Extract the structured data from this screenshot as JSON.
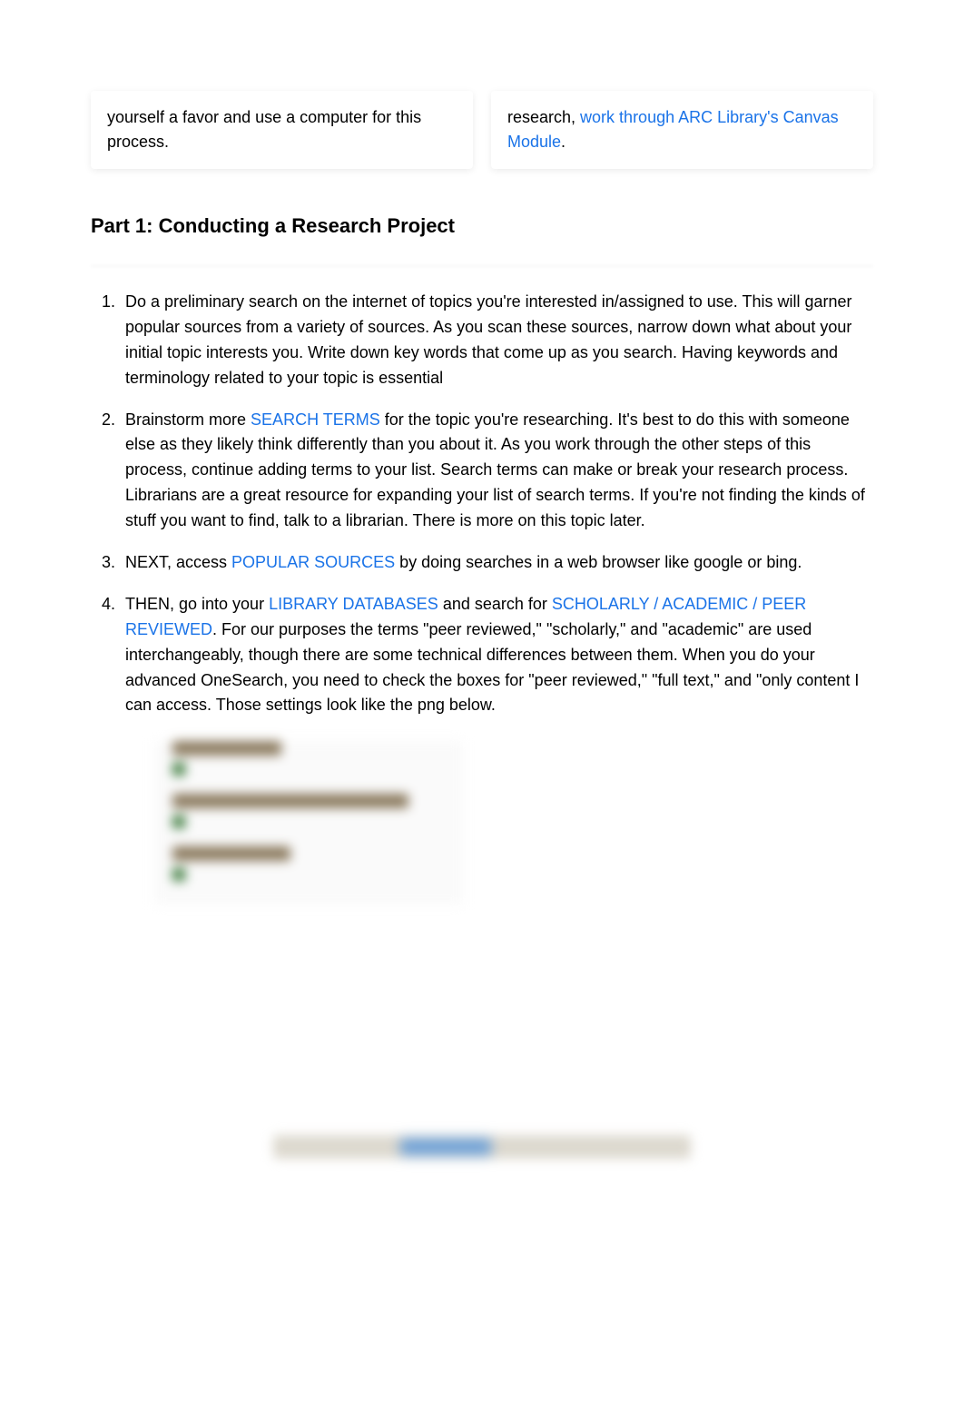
{
  "topBoxLeft": {
    "text": "yourself a favor and use a computer for this process."
  },
  "topBoxRight": {
    "prefix": "research, ",
    "linkText": "work through ARC Library's Canvas Module",
    "suffix": "."
  },
  "heading": "Part 1: Conducting a Research Project",
  "items": {
    "item1": "Do a preliminary search on the internet of topics you're interested in/assigned to use. This will garner popular sources from a variety of sources. As you scan these sources, narrow down what about your initial topic interests you. Write down key words that come up as you search. Having keywords and terminology related to your topic is essential",
    "item2": {
      "prefix": "Brainstorm more ",
      "link": "SEARCH TERMS",
      "suffix": " for the topic you're researching. It's best to do this with someone else as they likely think differently than you about it. As you work through the other steps of this process, continue adding terms to your list. Search terms can make or break your research process. Librarians are a great resource for expanding your list of search terms. If you're not finding the kinds of stuff you want to find, talk to a librarian. There is more on this topic later."
    },
    "item3": {
      "prefix": "NEXT, access ",
      "link": "POPULAR SOURCES",
      "suffix": " by doing searches in a web browser like google or bing."
    },
    "item4": {
      "prefix": "THEN, go into your ",
      "link1": "LIBRARY DATABASES",
      "mid": " and search for ",
      "link2": "SCHOLARLY / ACADEMIC / PEER REVIEWED",
      "suffix": ". For our purposes the terms \"peer reviewed,\" \"scholarly,\" and \"academic\" are used interchangeably, though there are some technical differences between them. When you do your advanced OneSearch, you need to check the boxes for \"peer reviewed,\" \"full text,\" and \"only content I can access. Those settings look like the png below."
    }
  }
}
